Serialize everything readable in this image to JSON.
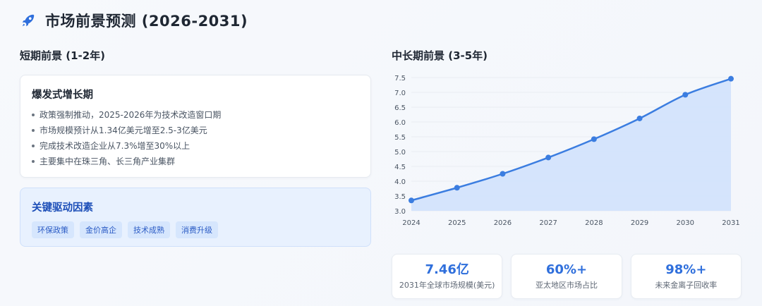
{
  "header": {
    "title": "市场前景预测 (2026-2031)",
    "icon": "rocket-icon"
  },
  "short_term": {
    "title": "短期前景 (1-2年)",
    "card": {
      "title": "爆发式增长期",
      "bullets": [
        "政策强制推动，2025-2026年为技术改造窗口期",
        "市场规模预计从1.34亿美元增至2.5-3亿美元",
        "完成技术改造企业从7.3%增至30%以上",
        "主要集中在珠三角、长三角产业集群"
      ]
    },
    "drivers": {
      "title": "关键驱动因素",
      "tags": [
        "环保政策",
        "金价高企",
        "技术成熟",
        "消费升级"
      ]
    }
  },
  "long_term": {
    "title": "中长期前景 (3-5年)"
  },
  "colors": {
    "accent": "#3b7de0",
    "fill": "#cfe0fb",
    "driver_title": "#1d4fb8"
  },
  "chart_data": {
    "type": "area",
    "x": [
      "2024",
      "2025",
      "2026",
      "2027",
      "2028",
      "2029",
      "2030",
      "2031"
    ],
    "values": [
      3.35,
      3.78,
      4.25,
      4.8,
      5.42,
      6.12,
      6.92,
      7.46
    ],
    "ylim": [
      3.0,
      7.5
    ],
    "yticks": [
      "3.0",
      "3.5",
      "4.0",
      "4.5",
      "5.0",
      "5.5",
      "6.0",
      "6.5",
      "7.0",
      "7.5"
    ],
    "grid": true,
    "title": "",
    "xlabel": "",
    "ylabel": ""
  },
  "stats": [
    {
      "value": "7.46亿",
      "label": "2031年全球市场规模(美元)"
    },
    {
      "value": "60%+",
      "label": "亚太地区市场占比"
    },
    {
      "value": "98%+",
      "label": "未来金离子回收率"
    }
  ]
}
